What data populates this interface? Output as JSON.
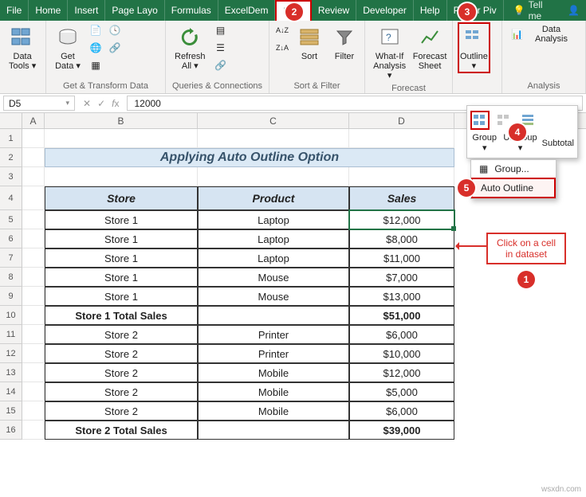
{
  "tabs": {
    "file": "File",
    "home": "Home",
    "insert": "Insert",
    "page_layout": "Page Layo",
    "formulas": "Formulas",
    "exceldemy": "ExcelDem",
    "data": "Data",
    "review": "Review",
    "developer": "Developer",
    "help": "Help",
    "powerpivot": "Power Piv",
    "tell_me": "Tell me"
  },
  "ribbon": {
    "data_tools": "Data\nTools ▾",
    "get_data": "Get\nData ▾",
    "refresh_all": "Refresh\nAll ▾",
    "sort": "Sort",
    "filter": "Filter",
    "whatif": "What-If\nAnalysis ▾",
    "forecast": "Forecast\nSheet",
    "outline": "Outline\n▾",
    "data_analysis": "Data Analysis",
    "group_get": "Get & Transform Data",
    "group_queries": "Queries & Connections",
    "group_sort": "Sort & Filter",
    "group_forecast": "Forecast",
    "group_analysis": "Analysis"
  },
  "outline_popup": {
    "group": "Group\n▾",
    "ungroup": "Ungroup\n▾",
    "subtotal": "Subtotal"
  },
  "group_menu": {
    "group": "Group...",
    "auto_outline": "Auto Outline",
    "underline_char": "A"
  },
  "name_box": "D5",
  "formula_value": "12000",
  "columns": [
    "A",
    "B",
    "C",
    "D"
  ],
  "title": "Applying Auto Outline Option",
  "headers": {
    "store": "Store",
    "product": "Product",
    "sales": "Sales"
  },
  "rows": [
    {
      "store": "Store 1",
      "product": "Laptop",
      "sales": "$12,000"
    },
    {
      "store": "Store 1",
      "product": "Laptop",
      "sales": "$8,000"
    },
    {
      "store": "Store 1",
      "product": "Laptop",
      "sales": "$11,000"
    },
    {
      "store": "Store 1",
      "product": "Mouse",
      "sales": "$7,000"
    },
    {
      "store": "Store 1",
      "product": "Mouse",
      "sales": "$13,000"
    },
    {
      "store": "Store 1 Total Sales",
      "product": "",
      "sales": "$51,000",
      "bold": true
    },
    {
      "store": "Store 2",
      "product": "Printer",
      "sales": "$6,000"
    },
    {
      "store": "Store 2",
      "product": "Printer",
      "sales": "$10,000"
    },
    {
      "store": "Store 2",
      "product": "Mobile",
      "sales": "$12,000"
    },
    {
      "store": "Store 2",
      "product": "Mobile",
      "sales": "$5,000"
    },
    {
      "store": "Store 2",
      "product": "Mobile",
      "sales": "$6,000"
    },
    {
      "store": "Store 2 Total Sales",
      "product": "",
      "sales": "$39,000",
      "bold": true
    }
  ],
  "callouts": {
    "b1": "1",
    "b2": "2",
    "b3": "3",
    "b4": "4",
    "b5": "5",
    "click_cell": "Click on a cell\nin dataset"
  },
  "watermark": "wsxdn.com"
}
